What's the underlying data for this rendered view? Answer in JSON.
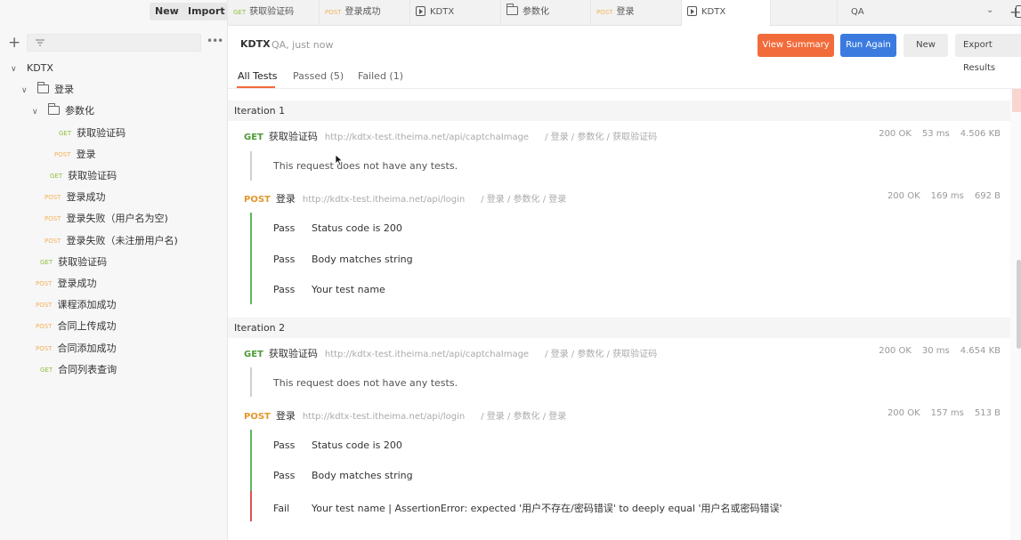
{
  "sidebar": {
    "new_label": "New",
    "import_label": "Import",
    "tree": [
      {
        "label": "KDTX",
        "type": "collection",
        "method": ""
      },
      {
        "label": "登录",
        "type": "folder",
        "method": ""
      },
      {
        "label": "参数化",
        "type": "folder",
        "method": ""
      },
      {
        "label": "获取验证码",
        "type": "request",
        "method": "GET"
      },
      {
        "label": "登录",
        "type": "request",
        "method": "POST"
      },
      {
        "label": "获取验证码",
        "type": "request",
        "method": "GET"
      },
      {
        "label": "登录成功",
        "type": "request",
        "method": "POST"
      },
      {
        "label": "登录失败（用户名为空)",
        "type": "request",
        "method": "POST"
      },
      {
        "label": "登录失败（未注册用户名)",
        "type": "request",
        "method": "POST"
      },
      {
        "label": "获取验证码",
        "type": "request",
        "method": "GET"
      },
      {
        "label": "登录成功",
        "type": "request",
        "method": "POST"
      },
      {
        "label": "课程添加成功",
        "type": "request",
        "method": "POST"
      },
      {
        "label": "合同上传成功",
        "type": "request",
        "method": "POST"
      },
      {
        "label": "合同添加成功",
        "type": "request",
        "method": "POST"
      },
      {
        "label": "合同列表查询",
        "type": "request",
        "method": "GET"
      }
    ]
  },
  "tabs": [
    {
      "method": "GET",
      "label": "获取验证码",
      "icon": ""
    },
    {
      "method": "POST",
      "label": "登录成功",
      "icon": ""
    },
    {
      "method": "",
      "label": "KDTX",
      "icon": "play-icon"
    },
    {
      "method": "",
      "label": "参数化",
      "icon": "folder-icon"
    },
    {
      "method": "POST",
      "label": "登录",
      "icon": ""
    },
    {
      "method": "",
      "label": "KDTX",
      "icon": "play-icon"
    }
  ],
  "environment": "QA",
  "header": {
    "title": "KDTX",
    "meta": "QA, just now",
    "view_summary": "View Summary",
    "run_again": "Run Again",
    "new": "New",
    "export": "Export Results"
  },
  "filter_tabs": {
    "all": "All Tests",
    "passed": "Passed (5)",
    "failed": "Failed (1)"
  },
  "iterations": [
    {
      "label": "Iteration 1",
      "requests": [
        {
          "method": "GET",
          "name": "获取验证码",
          "url": "http://kdtx-test.itheima.net/api/captchaImage",
          "path": "/ 登录 / 参数化 / 获取验证码",
          "status": "200 OK",
          "time": "53 ms",
          "size": "4.506 KB",
          "note": "This request does not have any tests.",
          "tests": []
        },
        {
          "method": "POST",
          "name": "登录",
          "url": "http://kdtx-test.itheima.net/api/login",
          "path": "/ 登录 / 参数化 / 登录",
          "status": "200 OK",
          "time": "169 ms",
          "size": "692 B",
          "note": "",
          "tests": [
            {
              "status": "Pass",
              "text": "Status code is 200"
            },
            {
              "status": "Pass",
              "text": "Body matches string"
            },
            {
              "status": "Pass",
              "text": "Your test name"
            }
          ]
        }
      ]
    },
    {
      "label": "Iteration 2",
      "requests": [
        {
          "method": "GET",
          "name": "获取验证码",
          "url": "http://kdtx-test.itheima.net/api/captchaImage",
          "path": "/ 登录 / 参数化 / 获取验证码",
          "status": "200 OK",
          "time": "30 ms",
          "size": "4.654 KB",
          "note": "This request does not have any tests.",
          "tests": []
        },
        {
          "method": "POST",
          "name": "登录",
          "url": "http://kdtx-test.itheima.net/api/login",
          "path": "/ 登录 / 参数化 / 登录",
          "status": "200 OK",
          "time": "157 ms",
          "size": "513 B",
          "note": "",
          "tests": [
            {
              "status": "Pass",
              "text": "Status code is 200"
            },
            {
              "status": "Pass",
              "text": "Body matches string"
            },
            {
              "status": "Fail",
              "text": "Your test name | AssertionError: expected '用户不存在/密码错误' to deeply equal '用户名或密码错误'"
            }
          ]
        }
      ]
    }
  ],
  "colors": {
    "accent_orange": "#f26b3a",
    "primary_blue": "#3b7be0",
    "get_green": "#4d9b38",
    "post_orange": "#e3962c",
    "pass_bar": "#5cb85c",
    "fail_bar": "#d9534f"
  }
}
